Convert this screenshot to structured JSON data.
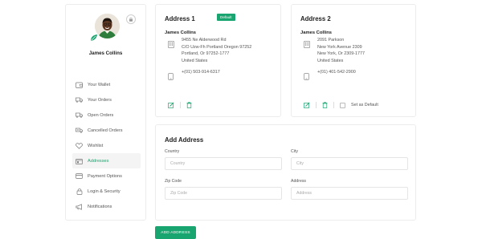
{
  "profile": {
    "name": "James Collins"
  },
  "menu": [
    {
      "label": "Your Wallet",
      "icon": "wallet-icon"
    },
    {
      "label": "Your Orders",
      "icon": "truck-icon"
    },
    {
      "label": "Open Orders",
      "icon": "truck-icon"
    },
    {
      "label": "Cancelled Orders",
      "icon": "truck-cancel-icon"
    },
    {
      "label": "Wishlist",
      "icon": "heart-icon"
    },
    {
      "label": "Addresses",
      "icon": "address-icon",
      "active": true
    },
    {
      "label": "Payment Options",
      "icon": "card-icon"
    },
    {
      "label": "Login & Security",
      "icon": "lock-icon"
    },
    {
      "label": "Notifications",
      "icon": "megaphone-icon"
    }
  ],
  "address1": {
    "title": "Address 1",
    "badge": "Default",
    "name": "James Collins",
    "line1": "9455 Ne Alderwood Rd",
    "line2": "C/O Uzw-Fh Portland Oregon 97252",
    "line3": "Portland, Or 97252-1777",
    "line4": "United States",
    "phone": "+(01) 503-914-6317"
  },
  "address2": {
    "title": "Address 2",
    "name": "James Collins",
    "line1": "2091 Parkson",
    "line2": "New York Avenue 2309",
    "line3": "New York, Or 2309-1777",
    "line4": "United States",
    "phone": "+(01) 401-542-2900",
    "set_default": "Set as Default"
  },
  "add_address": {
    "title": "Add Address",
    "country_label": "Country",
    "country_placeholder": "Country",
    "city_label": "City",
    "city_placeholder": "City",
    "zip_label": "Zip Code",
    "zip_placeholder": "Zip Code",
    "address_label": "Address",
    "address_placeholder": "Address",
    "button": "ADD ADDRESS"
  },
  "colors": {
    "accent": "#19a56f"
  }
}
